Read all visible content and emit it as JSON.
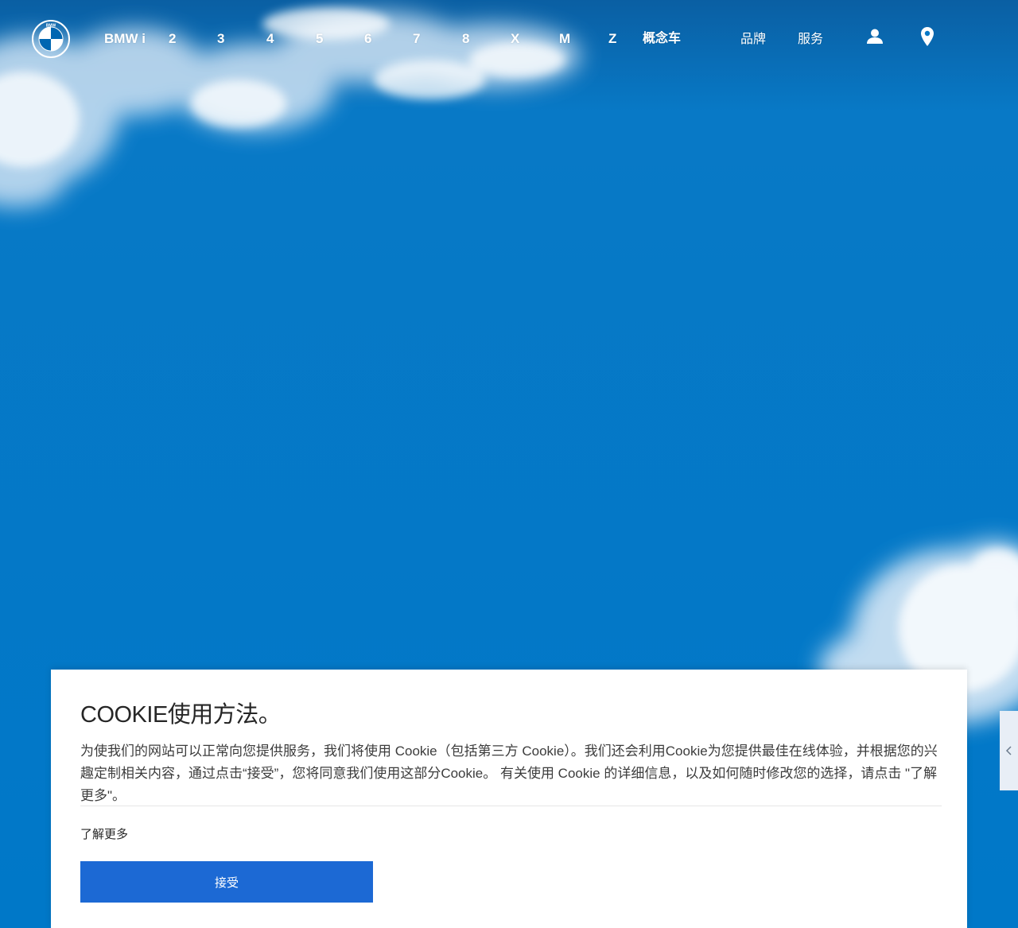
{
  "nav": {
    "items": [
      {
        "label": "BMW i"
      },
      {
        "label": "2"
      },
      {
        "label": "3"
      },
      {
        "label": "4"
      },
      {
        "label": "5"
      },
      {
        "label": "6"
      },
      {
        "label": "7"
      },
      {
        "label": "8"
      },
      {
        "label": "X"
      },
      {
        "label": "M"
      },
      {
        "label": "Z"
      },
      {
        "label": "概念车"
      }
    ],
    "brand_label": "品牌",
    "service_label": "服务",
    "logo_text": "BMW",
    "icons": [
      "user-icon",
      "location-pin-icon"
    ]
  },
  "cookie": {
    "title": "COOKIE使用方法。",
    "text": "为使我们的网站可以正常向您提供服务，我们将使用 Cookie（包括第三方 Cookie）。我们还会利用Cookie为您提供最佳在线体验，并根据您的兴趣定制相关内容，通过点击“接受”，您将同意我们使用这部分Cookie。 有关使用 Cookie 的详细信息，以及如何随时修改您的选择，请点击 \"了解更多\"。",
    "learn_more": "了解更多",
    "accept": "接受"
  },
  "colors": {
    "sky": "#0078c8",
    "accent": "#1c69d4",
    "banner_bg": "#ffffff"
  }
}
